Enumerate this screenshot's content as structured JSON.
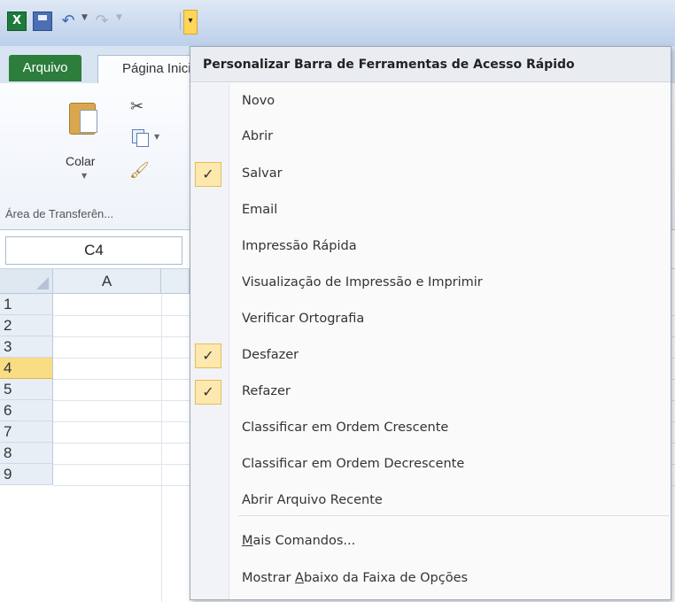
{
  "qat": {
    "app_icon_label": "X"
  },
  "tabs": {
    "file": "Arquivo",
    "home": "Página Inicial"
  },
  "ribbon": {
    "paste_label": "Colar",
    "group_label": "Área de Transferên..."
  },
  "formula_bar": {
    "namebox": "C4"
  },
  "sheet": {
    "column_a": "A",
    "rows": [
      "1",
      "2",
      "3",
      "4",
      "5",
      "6",
      "7",
      "8",
      "9"
    ],
    "active_row": "4"
  },
  "menu": {
    "title": "Personalizar Barra de Ferramentas de Acesso Rápido",
    "items": [
      {
        "label": "Novo",
        "checked": false
      },
      {
        "label": "Abrir",
        "checked": false
      },
      {
        "label": "Salvar",
        "checked": true
      },
      {
        "label": "Email",
        "checked": false
      },
      {
        "label": "Impressão Rápida",
        "checked": false
      },
      {
        "label": "Visualização de Impressão e Imprimir",
        "checked": false
      },
      {
        "label": "Verificar Ortografia",
        "checked": false
      },
      {
        "label": "Desfazer",
        "checked": true
      },
      {
        "label": "Refazer",
        "checked": true
      },
      {
        "label": "Classificar em Ordem Crescente",
        "checked": false
      },
      {
        "label": "Classificar em Ordem Decrescente",
        "checked": false
      },
      {
        "label": "Abrir Arquivo Recente",
        "checked": false
      }
    ],
    "more_commands": {
      "label": "Mais Comandos...",
      "underline": "M",
      "rest": "ais Comandos..."
    },
    "show_below": {
      "label": "Mostrar Abaixo da Faixa de Opções",
      "pre": "Mostrar ",
      "underline": "A",
      "rest": "baixo da Faixa de Opções"
    },
    "check_glyph": "✓"
  }
}
